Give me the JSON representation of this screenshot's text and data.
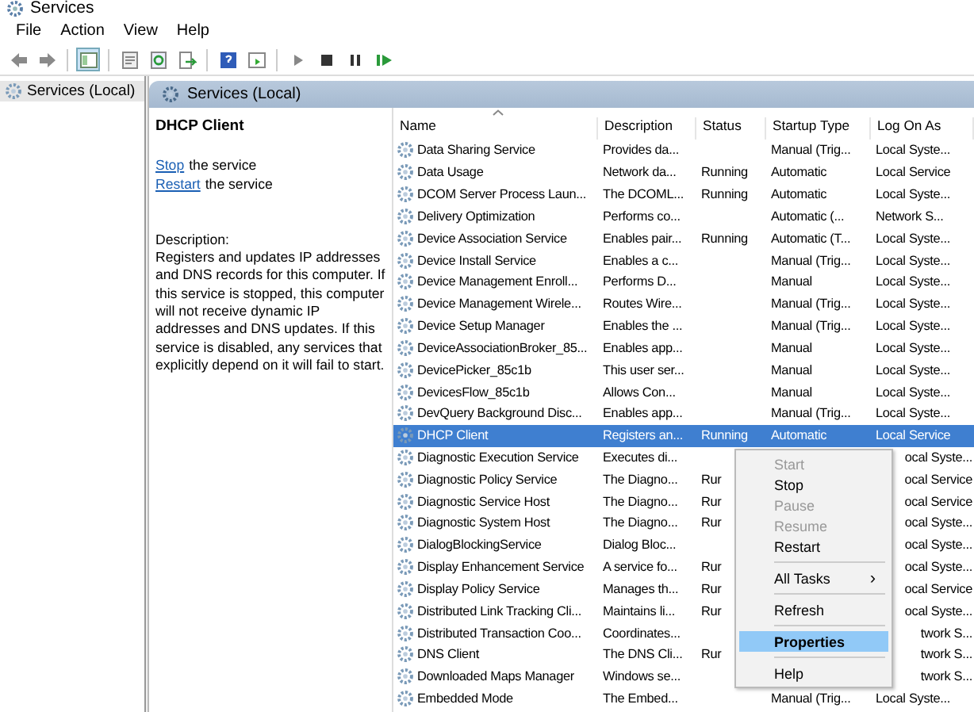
{
  "window": {
    "title": "Services"
  },
  "menu_bar": [
    "File",
    "Action",
    "View",
    "Help"
  ],
  "toolbar": [
    {
      "kind": "back",
      "selected": false
    },
    {
      "kind": "forward",
      "selected": false
    },
    {
      "kind": "sep"
    },
    {
      "kind": "tree",
      "selected": true
    },
    {
      "kind": "sep"
    },
    {
      "kind": "props",
      "selected": false
    },
    {
      "kind": "refresh",
      "selected": false
    },
    {
      "kind": "export",
      "selected": false
    },
    {
      "kind": "sep"
    },
    {
      "kind": "help",
      "selected": false
    },
    {
      "kind": "view",
      "selected": false
    },
    {
      "kind": "sep"
    },
    {
      "kind": "play",
      "selected": false
    },
    {
      "kind": "stop",
      "selected": false
    },
    {
      "kind": "pause",
      "selected": false
    },
    {
      "kind": "resume",
      "selected": false
    }
  ],
  "tree": [
    {
      "label": "Services (Local)",
      "selected": true
    }
  ],
  "pane_header": "Services (Local)",
  "detail": {
    "title": "DHCP Client",
    "actions": [
      {
        "link": "Stop",
        "text": "the service"
      },
      {
        "link": "Restart",
        "text": "the service"
      }
    ],
    "description_label": "Description:",
    "description": "Registers and updates IP addresses and DNS records for this computer. If this service is stopped, this computer will not receive dynamic IP addresses and DNS updates. If this service is disabled, any services that explicitly depend on it will fail to start."
  },
  "table": {
    "columns": [
      "Name",
      "Description",
      "Status",
      "Startup Type",
      "Log On As"
    ],
    "rows": [
      {
        "name": "Data Sharing Service",
        "description": "Provides da...",
        "startup": "Manual (Trig...",
        "logon": "Local Syste...",
        "selected": false
      },
      {
        "name": "Data Usage",
        "description": "Network da...",
        "status": "Running",
        "startup": "Automatic",
        "logon": "Local Service",
        "selected": false
      },
      {
        "name": "DCOM Server Process Laun...",
        "description": "The DCOML...",
        "status": "Running",
        "startup": "Automatic",
        "logon": "Local Syste...",
        "selected": false
      },
      {
        "name": "Delivery Optimization",
        "description": "Performs co...",
        "startup": "Automatic (...",
        "logon": "Network S...",
        "selected": false
      },
      {
        "name": "Device Association Service",
        "description": "Enables pair...",
        "status": "Running",
        "startup": "Automatic (T...",
        "logon": "Local Syste...",
        "selected": false
      },
      {
        "name": "Device Install Service",
        "description": "Enables a c...",
        "startup": "Manual (Trig...",
        "logon": "Local Syste...",
        "selected": false
      },
      {
        "name": "Device Management Enroll...",
        "description": "Performs D...",
        "startup": "Manual",
        "logon": "Local Syste...",
        "selected": false
      },
      {
        "name": "Device Management Wirele...",
        "description": "Routes Wire...",
        "startup": "Manual (Trig...",
        "logon": "Local Syste...",
        "selected": false
      },
      {
        "name": "Device Setup Manager",
        "description": "Enables the ...",
        "startup": "Manual (Trig...",
        "logon": "Local Syste...",
        "selected": false
      },
      {
        "name": "DeviceAssociationBroker_85...",
        "description": "Enables app...",
        "startup": "Manual",
        "logon": "Local Syste...",
        "selected": false
      },
      {
        "name": "DevicePicker_85c1b",
        "description": "This user ser...",
        "startup": "Manual",
        "logon": "Local Syste...",
        "selected": false
      },
      {
        "name": "DevicesFlow_85c1b",
        "description": "Allows Con...",
        "startup": "Manual",
        "logon": "Local Syste...",
        "selected": false
      },
      {
        "name": "DevQuery Background Disc...",
        "description": "Enables app...",
        "startup": "Manual (Trig...",
        "logon": "Local Syste...",
        "selected": false
      },
      {
        "name": "DHCP Client",
        "description": "Registers an...",
        "status": "Running",
        "startup": "Automatic",
        "logon": "Local Service",
        "selected": true
      },
      {
        "name": "Diagnostic Execution Service",
        "description": "Executes di...",
        "logon": "ocal Syste...",
        "selected": false
      },
      {
        "name": "Diagnostic Policy Service",
        "description": "The Diagno...",
        "status": "Rur",
        "logon": "ocal Service",
        "selected": false
      },
      {
        "name": "Diagnostic Service Host",
        "description": "The Diagno...",
        "status": "Rur",
        "logon": "ocal Service",
        "selected": false
      },
      {
        "name": "Diagnostic System Host",
        "description": "The Diagno...",
        "status": "Rur",
        "logon": "ocal Syste...",
        "selected": false
      },
      {
        "name": "DialogBlockingService",
        "description": "Dialog Bloc...",
        "logon": "ocal Syste...",
        "selected": false
      },
      {
        "name": "Display Enhancement Service",
        "description": "A service fo...",
        "status": "Rur",
        "logon": "ocal Syste...",
        "selected": false
      },
      {
        "name": "Display Policy Service",
        "description": "Manages th...",
        "status": "Rur",
        "logon": "ocal Service",
        "selected": false
      },
      {
        "name": "Distributed Link Tracking Cli...",
        "description": "Maintains li...",
        "status": "Rur",
        "logon": "ocal Syste...",
        "selected": false
      },
      {
        "name": "Distributed Transaction Coo...",
        "description": "Coordinates...",
        "logon": "twork S...",
        "selected": false
      },
      {
        "name": "DNS Client",
        "description": "The DNS Cli...",
        "status": "Rur",
        "logon": "twork S...",
        "selected": false
      },
      {
        "name": "Downloaded Maps Manager",
        "description": "Windows se...",
        "logon": "twork S...",
        "selected": false
      },
      {
        "name": "Embedded Mode",
        "description": "The Embed...",
        "startup": "Manual (Trig...",
        "logon": "Local Syste...",
        "selected": false
      }
    ]
  },
  "context_menu": [
    {
      "kind": "item",
      "label": "Start",
      "disabled": true,
      "selected": false
    },
    {
      "kind": "item",
      "label": "Stop",
      "disabled": false,
      "selected": false
    },
    {
      "kind": "item",
      "label": "Pause",
      "disabled": true,
      "selected": false
    },
    {
      "kind": "item",
      "label": "Resume",
      "disabled": true,
      "selected": false
    },
    {
      "kind": "item",
      "label": "Restart",
      "disabled": false,
      "selected": false
    },
    {
      "kind": "separator"
    },
    {
      "kind": "submenu",
      "label": "All Tasks",
      "arrow": "›",
      "disabled": false,
      "selected": false
    },
    {
      "kind": "separator"
    },
    {
      "kind": "item",
      "label": "Refresh",
      "disabled": false,
      "selected": false
    },
    {
      "kind": "separator"
    },
    {
      "kind": "item",
      "label": "Properties",
      "disabled": false,
      "selected": true
    },
    {
      "kind": "separator"
    },
    {
      "kind": "item",
      "label": "Help",
      "disabled": false,
      "selected": false
    }
  ]
}
